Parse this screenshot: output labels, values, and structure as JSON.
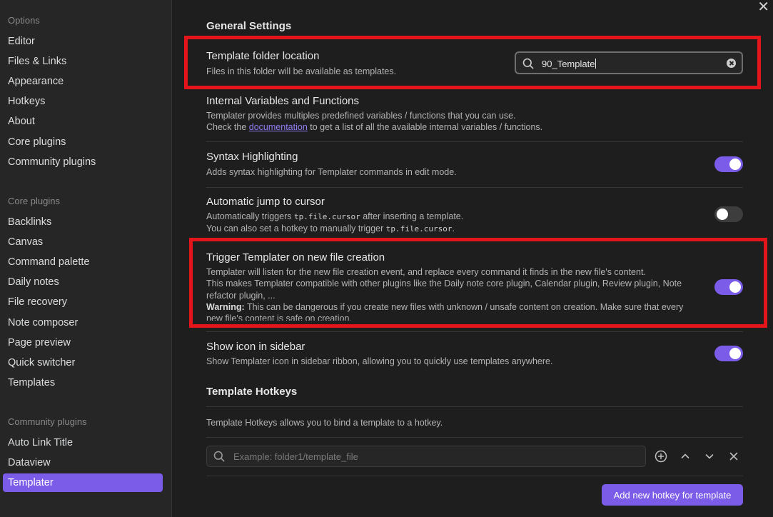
{
  "sidebar": {
    "options_title": "Options",
    "options": [
      "Editor",
      "Files & Links",
      "Appearance",
      "Hotkeys",
      "About",
      "Core plugins",
      "Community plugins"
    ],
    "core_title": "Core plugins",
    "core": [
      "Backlinks",
      "Canvas",
      "Command palette",
      "Daily notes",
      "File recovery",
      "Note composer",
      "Page preview",
      "Quick switcher",
      "Templates"
    ],
    "community_title": "Community plugins",
    "community": [
      "Auto Link Title",
      "Dataview",
      "Templater"
    ],
    "active_item": "Templater"
  },
  "main": {
    "general_title": "General Settings",
    "folder": {
      "name": "Template folder location",
      "desc": "Files in this folder will be available as templates.",
      "value": "90_Template"
    },
    "internal": {
      "name": "Internal Variables and Functions",
      "line1": "Templater provides multiples predefined variables / functions that you can use.",
      "line2_pre": "Check the",
      "link": "documentation",
      "line2_post": "to get a list of all the available internal variables / functions."
    },
    "syntax": {
      "name": "Syntax Highlighting",
      "desc": "Adds syntax highlighting for Templater commands in edit mode.",
      "enabled": true
    },
    "jump": {
      "name": "Automatic jump to cursor",
      "line1_pre": "Automatically triggers",
      "code": "tp.file.cursor",
      "line1_post": "after inserting a template.",
      "line2_pre": "You can also set a hotkey to manually trigger",
      "line2_post": ".",
      "enabled": false
    },
    "trigger": {
      "name": "Trigger Templater on new file creation",
      "line1": "Templater will listen for the new file creation event, and replace every command it finds in the new file's content.",
      "line2": "This makes Templater compatible with other plugins like the Daily note core plugin, Calendar plugin, Review plugin, Note refactor plugin, ...",
      "warning_label": "Warning:",
      "warning_text": "This can be dangerous if you create new files with unknown / unsafe content on creation. Make sure that every new file's content is safe on creation.",
      "enabled": true
    },
    "show_icon": {
      "name": "Show icon in sidebar",
      "desc": "Show Templater icon in sidebar ribbon, allowing you to quickly use templates anywhere.",
      "enabled": true
    },
    "hotkeys_title": "Template Hotkeys",
    "hotkeys_desc": "Template Hotkeys allows you to bind a template to a hotkey.",
    "hotkey_placeholder": "Example: folder1/template_file",
    "add_button": "Add new hotkey for template"
  },
  "colors": {
    "accent": "#7b5ce8",
    "highlight_box": "#e3151b",
    "background": "#1e1e1e",
    "sidebar": "#262626"
  },
  "icons": [
    "close-icon",
    "search-icon",
    "clear-icon",
    "add-circle-icon",
    "chevron-up-icon",
    "chevron-down-icon",
    "delete-x-icon"
  ]
}
